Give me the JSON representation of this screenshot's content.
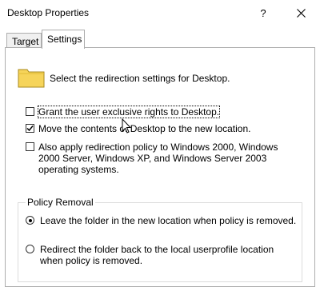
{
  "window": {
    "title": "Desktop Properties",
    "help_label": "?",
    "close_icon": "close-icon"
  },
  "tabs": [
    {
      "label": "Target",
      "selected": false
    },
    {
      "label": "Settings",
      "selected": true
    }
  ],
  "settings": {
    "description": "Select the redirection settings for Desktop.",
    "folder_icon": "folder-icon",
    "checkboxes": [
      {
        "label": "Grant the user exclusive rights to Desktop.",
        "checked": false
      },
      {
        "label": "Move the contents of Desktop to the new location.",
        "checked": true
      },
      {
        "label": "Also apply redirection policy to Windows 2000, Windows 2000 Server, Windows XP, and Windows Server 2003 operating systems.",
        "checked": false
      }
    ]
  },
  "policy_removal": {
    "legend": "Policy Removal",
    "options": [
      {
        "label": "Leave the folder in the new location when policy is removed.",
        "selected": true
      },
      {
        "label": "Redirect the folder back to the local userprofile location when policy is removed.",
        "selected": false
      }
    ]
  },
  "colors": {
    "border": "#adadad",
    "folder_fill": "#f6d45a",
    "folder_stroke": "#a88a1e"
  }
}
